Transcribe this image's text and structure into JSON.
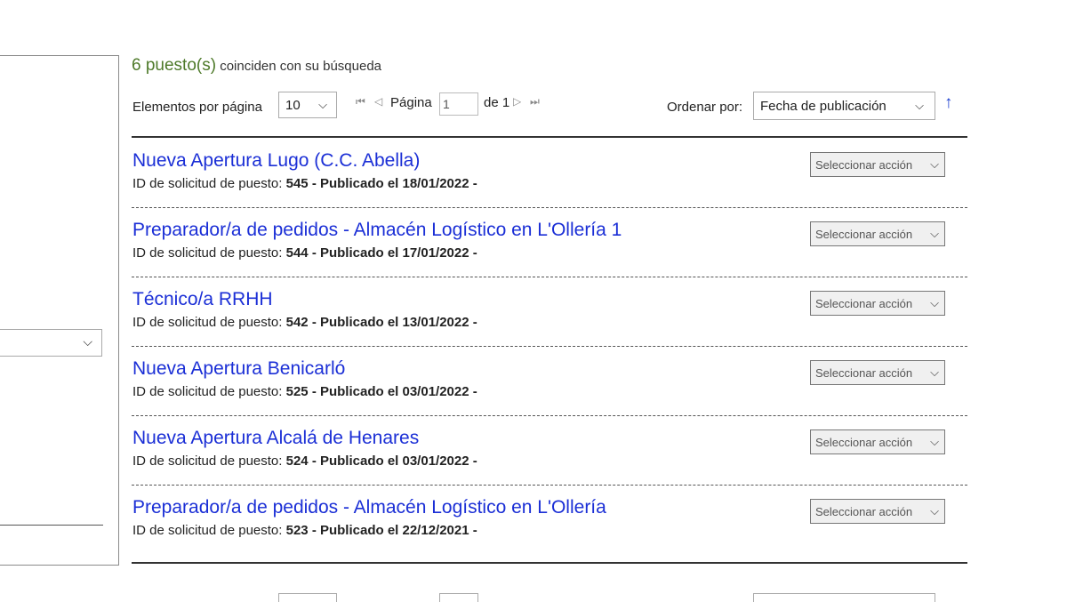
{
  "results": {
    "count": "6 puesto(s)",
    "suffix": " coinciden con su búsqueda"
  },
  "toolbar": {
    "per_page_label": "Elementos por página",
    "per_page_value": "10",
    "page_label": "Página",
    "page_value": "1",
    "page_of": "de 1",
    "sort_label": "Ordenar por:",
    "sort_value": "Fecha de publicación"
  },
  "jobs": [
    {
      "title": "Nueva Apertura Lugo (C.C. Abella)",
      "id_label": "ID de solicitud de puesto:",
      "id": "545",
      "published": "- Publicado el 18/01/2022 -",
      "action": "Seleccionar acción"
    },
    {
      "title": "Preparador/a de pedidos - Almacén Logístico en L'Ollería 1",
      "id_label": "ID de solicitud de puesto:",
      "id": "544",
      "published": "- Publicado el 17/01/2022 -",
      "action": "Seleccionar acción"
    },
    {
      "title": "Técnico/a RRHH",
      "id_label": "ID de solicitud de puesto:",
      "id": "542",
      "published": "- Publicado el 13/01/2022 -",
      "action": "Seleccionar acción"
    },
    {
      "title": "Nueva Apertura Benicarló",
      "id_label": "ID de solicitud de puesto:",
      "id": "525",
      "published": "- Publicado el 03/01/2022 -",
      "action": "Seleccionar acción"
    },
    {
      "title": "Nueva Apertura Alcalá de Henares",
      "id_label": "ID de solicitud de puesto:",
      "id": "524",
      "published": "- Publicado el 03/01/2022 -",
      "action": "Seleccionar acción"
    },
    {
      "title": "Preparador/a de pedidos - Almacén Logístico en L'Ollería",
      "id_label": "ID de solicitud de puesto:",
      "id": "523",
      "published": "- Publicado el 22/12/2021 -",
      "action": "Seleccionar acción"
    }
  ],
  "colors": {
    "link": "#1b2fd6",
    "count": "#4e7a2a",
    "sort_arrow": "#1b3fcf"
  }
}
